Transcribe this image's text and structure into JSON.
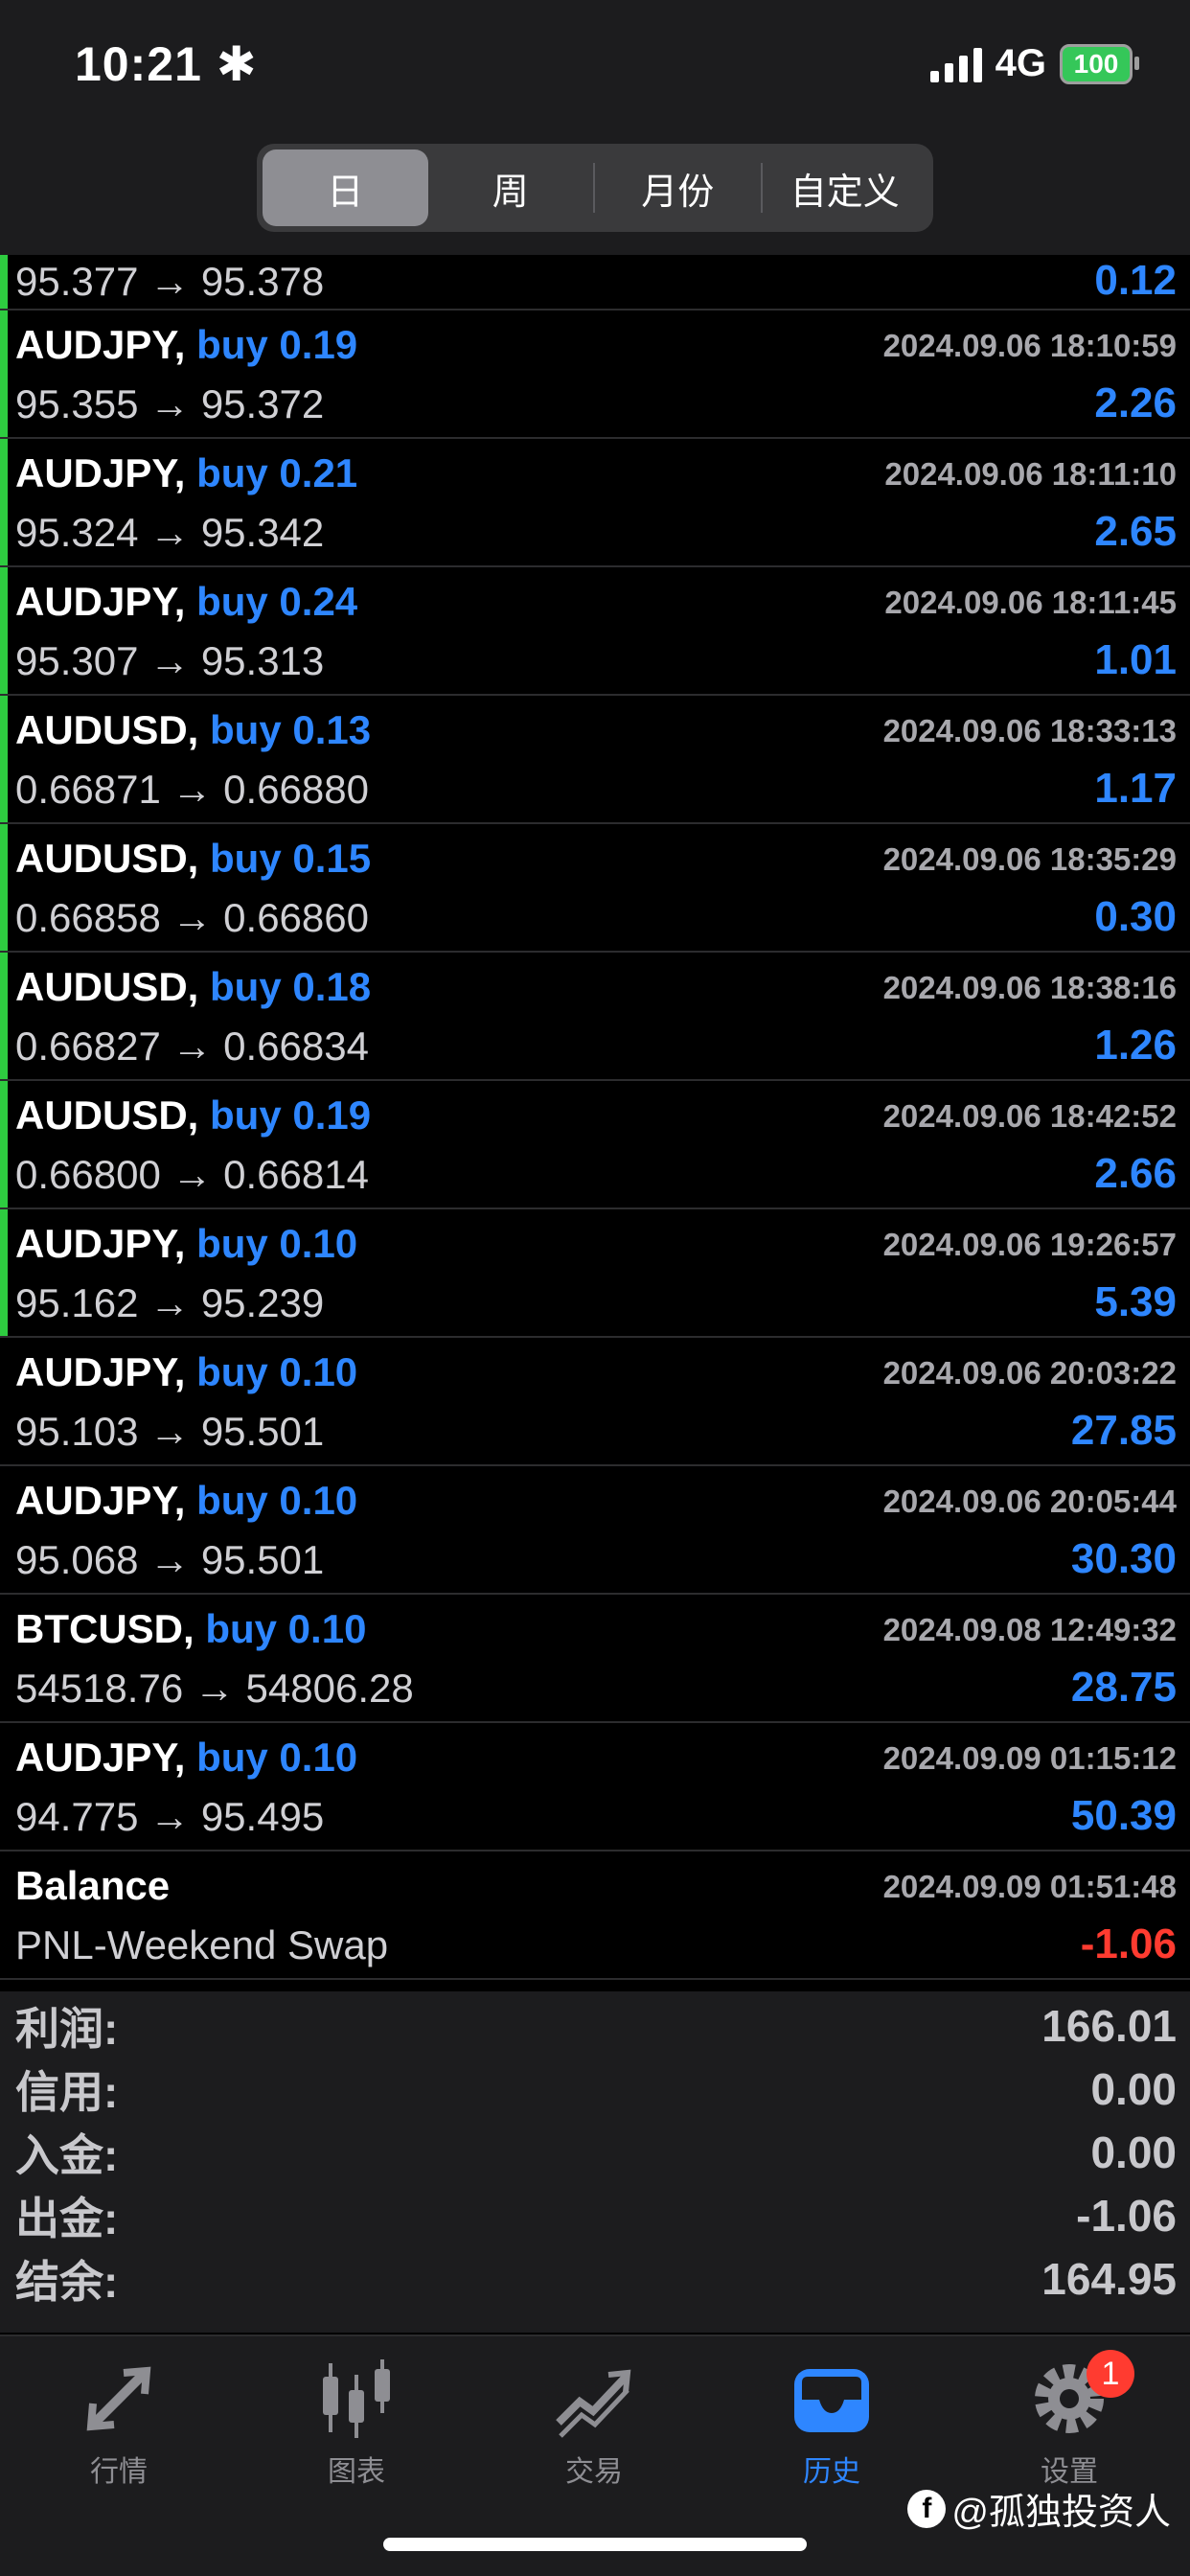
{
  "status": {
    "time": "10:21",
    "network": "4G",
    "battery": "100"
  },
  "segments": [
    "日",
    "周",
    "月份",
    "自定义"
  ],
  "trades": [
    {
      "symbol": "",
      "side": "",
      "time": "",
      "open": "95.377",
      "close": "95.378",
      "profit": "0.12"
    },
    {
      "symbol": "AUDJPY,",
      "side": "buy 0.19",
      "time": "2024.09.06 18:10:59",
      "open": "95.355",
      "close": "95.372",
      "profit": "2.26"
    },
    {
      "symbol": "AUDJPY,",
      "side": "buy 0.21",
      "time": "2024.09.06 18:11:10",
      "open": "95.324",
      "close": "95.342",
      "profit": "2.65"
    },
    {
      "symbol": "AUDJPY,",
      "side": "buy 0.24",
      "time": "2024.09.06 18:11:45",
      "open": "95.307",
      "close": "95.313",
      "profit": "1.01"
    },
    {
      "symbol": "AUDUSD,",
      "side": "buy 0.13",
      "time": "2024.09.06 18:33:13",
      "open": "0.66871",
      "close": "0.66880",
      "profit": "1.17"
    },
    {
      "symbol": "AUDUSD,",
      "side": "buy 0.15",
      "time": "2024.09.06 18:35:29",
      "open": "0.66858",
      "close": "0.66860",
      "profit": "0.30"
    },
    {
      "symbol": "AUDUSD,",
      "side": "buy 0.18",
      "time": "2024.09.06 18:38:16",
      "open": "0.66827",
      "close": "0.66834",
      "profit": "1.26"
    },
    {
      "symbol": "AUDUSD,",
      "side": "buy 0.19",
      "time": "2024.09.06 18:42:52",
      "open": "0.66800",
      "close": "0.66814",
      "profit": "2.66"
    },
    {
      "symbol": "AUDJPY,",
      "side": "buy 0.10",
      "time": "2024.09.06 19:26:57",
      "open": "95.162",
      "close": "95.239",
      "profit": "5.39"
    },
    {
      "symbol": "AUDJPY,",
      "side": "buy 0.10",
      "time": "2024.09.06 20:03:22",
      "open": "95.103",
      "close": "95.501",
      "profit": "27.85"
    },
    {
      "symbol": "AUDJPY,",
      "side": "buy 0.10",
      "time": "2024.09.06 20:05:44",
      "open": "95.068",
      "close": "95.501",
      "profit": "30.30"
    },
    {
      "symbol": "BTCUSD,",
      "side": "buy 0.10",
      "time": "2024.09.08 12:49:32",
      "open": "54518.76",
      "close": "54806.28",
      "profit": "28.75"
    },
    {
      "symbol": "AUDJPY,",
      "side": "buy 0.10",
      "time": "2024.09.09 01:15:12",
      "open": "94.775",
      "close": "95.495",
      "profit": "50.39"
    }
  ],
  "arrow": "→",
  "balance_entry": {
    "title": "Balance",
    "time": "2024.09.09 01:51:48",
    "comment": "PNL-Weekend Swap",
    "amount": "-1.06"
  },
  "summary": [
    {
      "label": "利润:",
      "value": "166.01"
    },
    {
      "label": "信用:",
      "value": "0.00"
    },
    {
      "label": "入金:",
      "value": "0.00"
    },
    {
      "label": "出金:",
      "value": "-1.06"
    },
    {
      "label": "结余:",
      "value": "164.95"
    }
  ],
  "tabs": [
    {
      "label": "行情",
      "icon": "quotes-arrows-icon"
    },
    {
      "label": "图表",
      "icon": "candlestick-chart-icon"
    },
    {
      "label": "交易",
      "icon": "trade-trend-icon"
    },
    {
      "label": "历史",
      "icon": "history-inbox-icon"
    },
    {
      "label": "设置",
      "icon": "gear-icon"
    }
  ],
  "settings_badge": "1",
  "watermark": "@孤独投资人",
  "colors": {
    "buy_blue": "#2e86ff",
    "loss_red": "#ff3b30",
    "accent_green": "#2ecc40"
  }
}
